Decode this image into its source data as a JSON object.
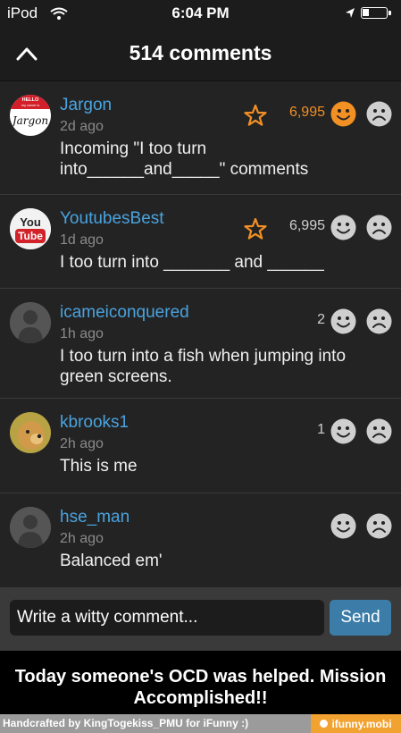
{
  "status_bar": {
    "carrier": "iPod",
    "time": "6:04 PM",
    "battery_percent": 20
  },
  "header": {
    "title": "514 comments"
  },
  "comments": [
    {
      "username": "Jargon",
      "time": "2d ago",
      "lines": [
        "Incoming \"I too turn",
        "into______and_____\" comments"
      ],
      "count": "6,995",
      "starred": true,
      "liked": true,
      "avatar": "hello-name-tag"
    },
    {
      "username": "YoutubesBest",
      "time": "1d ago",
      "lines": [
        "I too turn into _______ and ______"
      ],
      "count": "6,995",
      "starred": true,
      "liked": false,
      "avatar": "youtube-logo"
    },
    {
      "username": "icameiconquered",
      "time": "1h ago",
      "lines": [
        "I too turn into a fish when jumping into",
        "green screens."
      ],
      "count": "2",
      "starred": false,
      "liked": false,
      "avatar": "default-user"
    },
    {
      "username": "kbrooks1",
      "time": "2h ago",
      "lines": [
        "This is me"
      ],
      "count": "1",
      "starred": false,
      "liked": false,
      "avatar": "dog-photo"
    },
    {
      "username": "hse_man",
      "time": "2h ago",
      "lines": [
        "Balanced em'"
      ],
      "count": "",
      "starred": false,
      "liked": false,
      "avatar": "default-user"
    }
  ],
  "avatar_text": {
    "hello_top": "HELLO",
    "hello_sub": "my name is",
    "hello_name": "Jargon",
    "yt_top": "You",
    "yt_bottom": "Tube"
  },
  "input": {
    "placeholder": "Write a witty comment...",
    "send_label": "Send"
  },
  "caption": {
    "line1": "Today someone's OCD was helped. Mission",
    "line2": "Accomplished!!"
  },
  "footer": {
    "credit": "Handcrafted by KingTogekiss_PMU for iFunny :)",
    "brand": "ifunny.mobi"
  },
  "colors": {
    "accent_orange": "#f29024",
    "username_blue": "#4aa3df",
    "send_blue": "#3b7ca8",
    "face_gray": "#cfcfcf"
  },
  "icons": [
    "wifi-icon",
    "location-arrow-icon",
    "battery-icon",
    "chevron-up-icon",
    "star-icon",
    "smiley-icon",
    "sad-face-icon"
  ]
}
